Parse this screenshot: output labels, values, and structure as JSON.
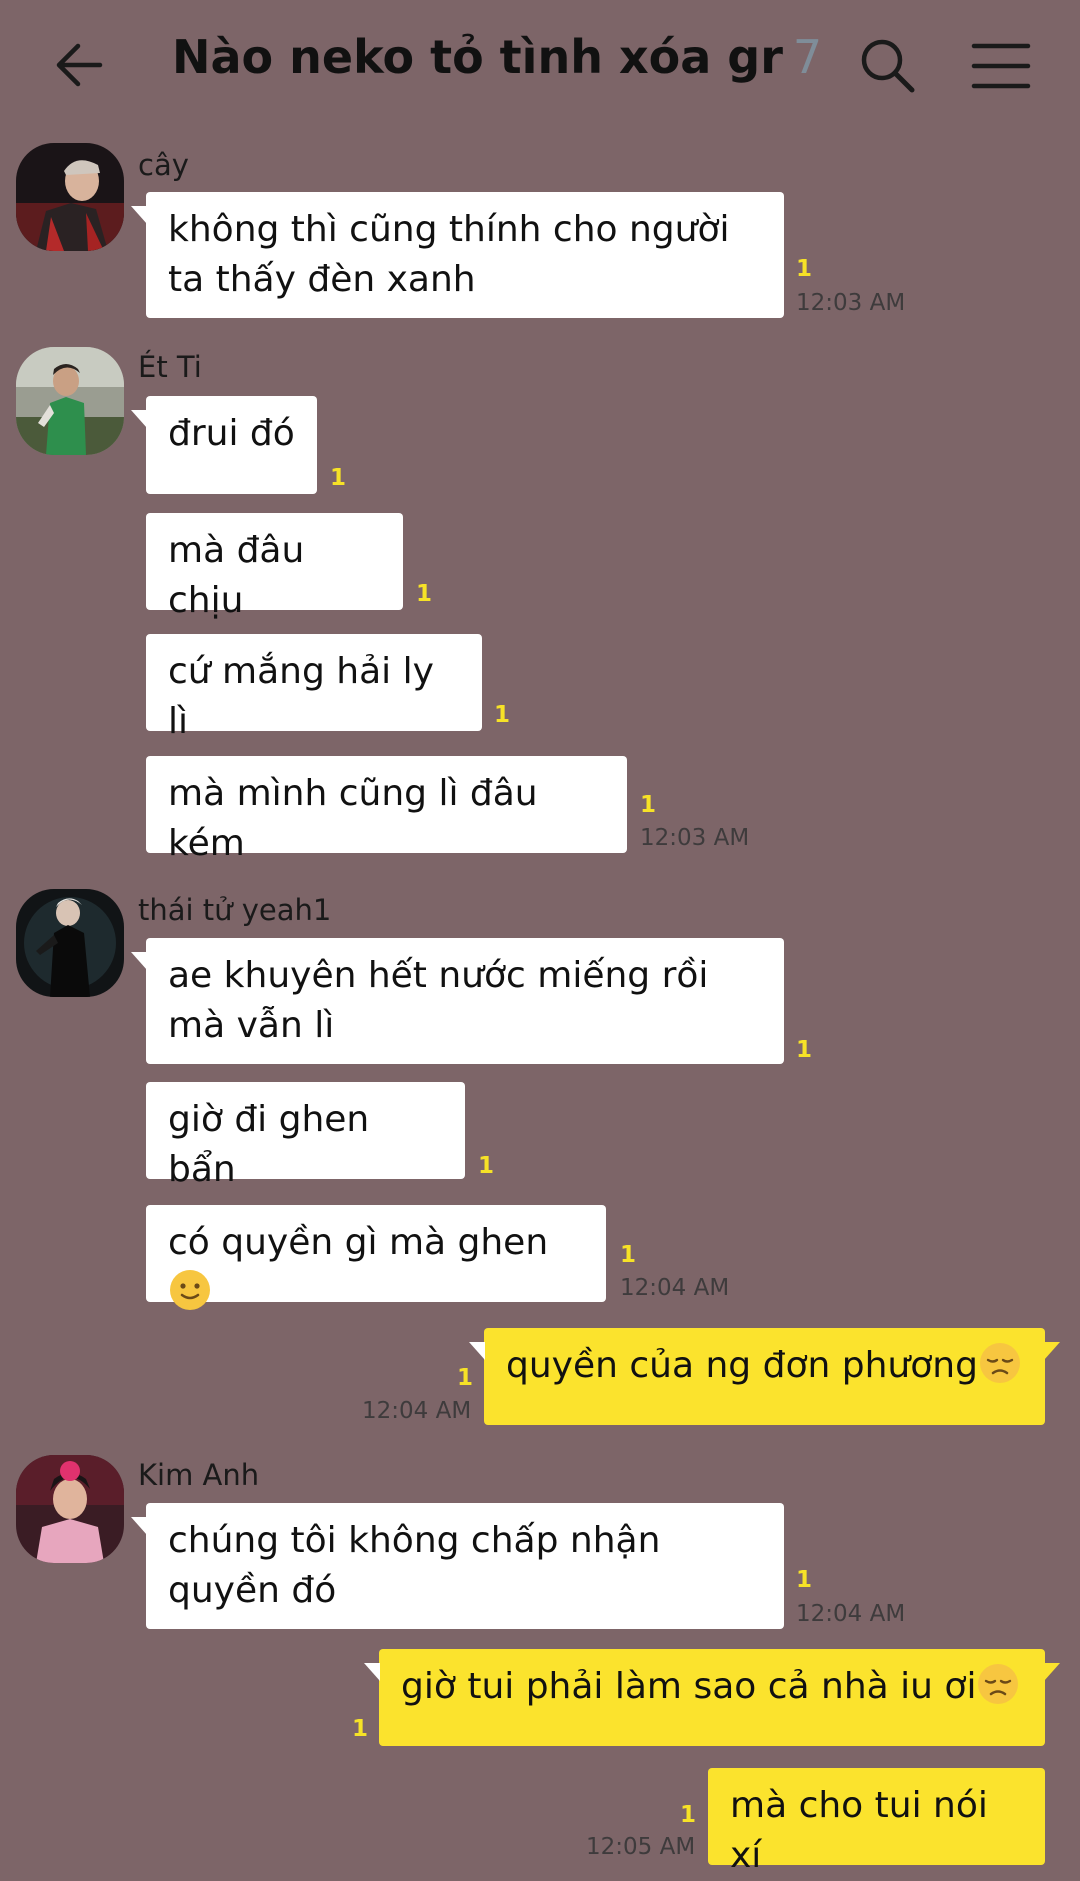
{
  "header": {
    "title": "Nào neko tỏ tình xóa gr",
    "member_count": "7",
    "back_icon": "arrow-left-icon",
    "search_icon": "search-icon",
    "menu_icon": "menu-icon"
  },
  "senders": {
    "s1": "cây",
    "s2": "Ét Ti",
    "s3": "thái tử yeah1",
    "s4": "Kim Anh"
  },
  "messages": {
    "m1": "không thì cũng thính cho người ta thấy đèn xanh",
    "m2": "đrui đó",
    "m3": "mà đâu chịu",
    "m4": "cứ mắng hải ly lì",
    "m5": "mà mình cũng lì đâu kém",
    "m6": "ae khuyên hết nước miếng rồi mà vẫn lì",
    "m7": "giờ đi ghen bẩn",
    "m8": "có quyền gì mà ghen",
    "m9": "quyền của ng đơn phương",
    "m10": "chúng tôi không chấp nhận quyền đó",
    "m11": "giờ tui phải làm sao cả nhà iu ơi",
    "m12": "mà cho tui nói xí"
  },
  "unread": "1",
  "times": {
    "t1": "12:03 AM",
    "t2": "12:03 AM",
    "t3": "12:04 AM",
    "t4": "12:04 AM",
    "t5": "12:04 AM",
    "t6": "12:05 AM"
  },
  "emojis": {
    "slight_smile": "slightly-smiling-face-icon",
    "disappointed": "disappointed-face-icon"
  },
  "colors": {
    "background": "#7d6568",
    "incoming_bubble": "#ffffff",
    "outgoing_bubble": "#fbe32d",
    "unread_count": "#f6e227"
  }
}
